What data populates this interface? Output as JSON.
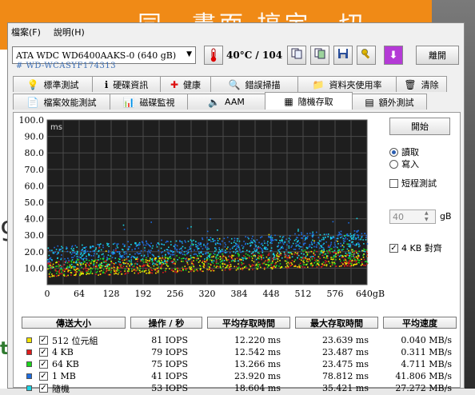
{
  "background": {
    "banner_text": "同一畫面 搞定一切",
    "left_letter_1": "9",
    "left_letter_2": "t"
  },
  "menu": {
    "file": "檔案(F)",
    "help": "說明(H)"
  },
  "toolbar": {
    "drive": "ATA   WDC WD6400AAKS-0 (640 gB)",
    "serial": "#   WD-WCASYF174313",
    "temperature": "40°C / 104",
    "exit_label": "離開"
  },
  "tabs_row1": [
    {
      "label": "標準測試",
      "icon": "bulb-icon"
    },
    {
      "label": "硬碟資訊",
      "icon": "info-icon"
    },
    {
      "label": "健康",
      "icon": "health-cross-icon"
    },
    {
      "label": "錯誤掃描",
      "icon": "scan-icon"
    },
    {
      "label": "資料夾使用率",
      "icon": "folder-icon"
    },
    {
      "label": "清除",
      "icon": "trash-icon"
    }
  ],
  "tabs_row2": [
    {
      "label": "檔案效能測試",
      "icon": "file-benchmark-icon"
    },
    {
      "label": "磁碟監視",
      "icon": "disk-monitor-icon"
    },
    {
      "label": "AAM",
      "icon": "speaker-icon"
    },
    {
      "label": "隨機存取",
      "icon": "random-access-icon"
    },
    {
      "label": "額外測試",
      "icon": "extra-tests-icon"
    }
  ],
  "controls": {
    "start_label": "開始",
    "read_label": "讀取",
    "write_label": "寫入",
    "short_test_label": "短程測試",
    "short_test_value": "40",
    "short_test_unit": "gB",
    "align_label": "4 KB 對齊"
  },
  "chart_data": {
    "type": "scatter",
    "ylabel": "ms",
    "xlabel": "",
    "ylim": [
      0,
      100
    ],
    "xlim": [
      0,
      640
    ],
    "y_ticks": [
      "100.0",
      "90.0",
      "80.0",
      "70.0",
      "60.0",
      "50.0",
      "40.0",
      "30.0",
      "20.0",
      "10.0"
    ],
    "x_ticks": [
      "0",
      "64",
      "128",
      "192",
      "256",
      "320",
      "384",
      "448",
      "512",
      "576",
      "640gB"
    ],
    "background_color": "#1e1e1e",
    "grid": true,
    "series": [
      {
        "name": "512 位元組",
        "color": "#f2e400",
        "band_start": [
          5,
          14
        ],
        "band_end": [
          12,
          22
        ]
      },
      {
        "name": "4 KB",
        "color": "#e01b1b",
        "band_start": [
          5,
          14
        ],
        "band_end": [
          12,
          22
        ]
      },
      {
        "name": "64 KB",
        "color": "#1bd61b",
        "band_start": [
          6,
          15
        ],
        "band_end": [
          13,
          23
        ]
      },
      {
        "name": "1 MB",
        "color": "#1e6de0",
        "band_start": [
          14,
          24
        ],
        "band_end": [
          24,
          34
        ]
      },
      {
        "name": "隨機",
        "color": "#19d6e6",
        "band_start": [
          10,
          24
        ],
        "band_end": [
          18,
          32
        ]
      }
    ]
  },
  "table": {
    "headers": [
      "傳送大小",
      "操作 / 秒",
      "平均存取時間",
      "最大存取時間",
      "平均速度"
    ],
    "rows": [
      {
        "label": "512 位元組",
        "color": "#f2e400",
        "checked": "✓",
        "iops": "81 IOPS",
        "avg": "12.220 ms",
        "max": "23.639 ms",
        "speed": "0.040 MB/s"
      },
      {
        "label": "4 KB",
        "color": "#e01b1b",
        "checked": "✓",
        "iops": "79 IOPS",
        "avg": "12.542 ms",
        "max": "23.487 ms",
        "speed": "0.311 MB/s"
      },
      {
        "label": "64 KB",
        "color": "#1bd61b",
        "checked": "✓",
        "iops": "75 IOPS",
        "avg": "13.266 ms",
        "max": "23.475 ms",
        "speed": "4.711 MB/s"
      },
      {
        "label": "1 MB",
        "color": "#1e6de0",
        "checked": "✓",
        "iops": "41 IOPS",
        "avg": "23.920 ms",
        "max": "78.812 ms",
        "speed": "41.806 MB/s"
      },
      {
        "label": "隨機",
        "color": "#19d6e6",
        "checked": "✓",
        "iops": "53 IOPS",
        "avg": "18.604 ms",
        "max": "35.421 ms",
        "speed": "27.272 MB/s"
      }
    ]
  }
}
